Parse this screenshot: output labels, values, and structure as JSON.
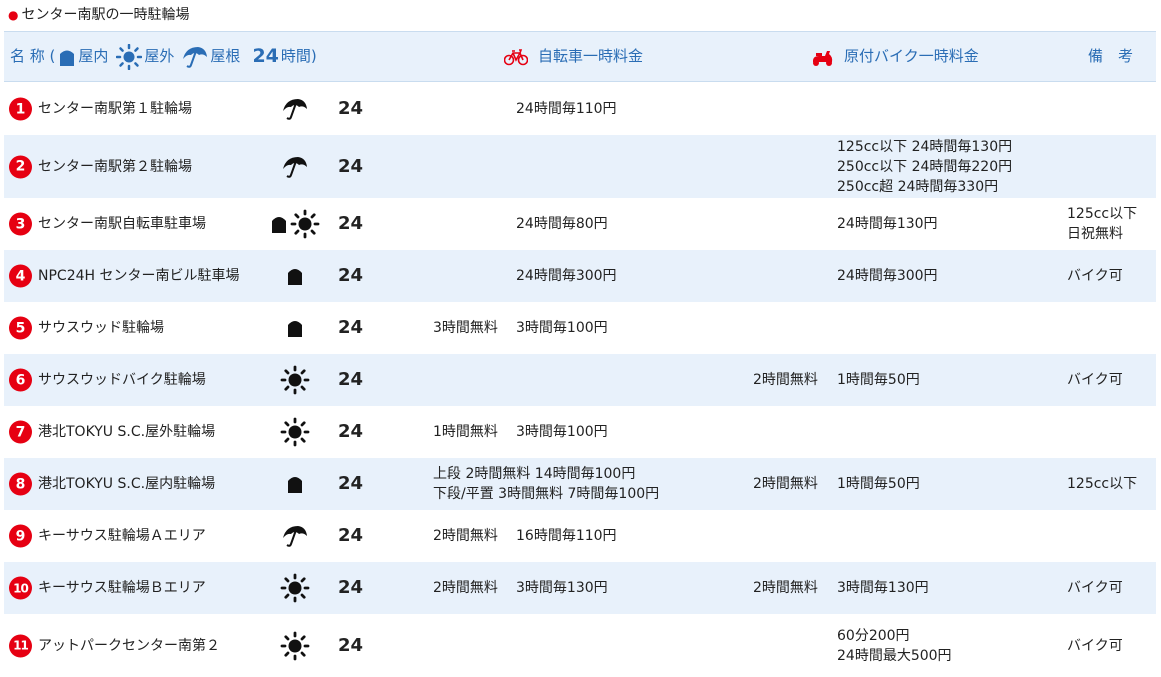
{
  "title": "センター南駅の一時駐輪場",
  "header": {
    "name_label": "名 称 (",
    "legend_indoor": "屋内",
    "legend_outdoor": "屋外",
    "legend_roof": "屋根",
    "legend_24": "24",
    "legend_24_suffix": "時間)",
    "bicycle_fee": "自転車一時料金",
    "moped_fee": "原付バイク一時料金",
    "notes": "備　考"
  },
  "colors": {
    "accent_red": "#e60012",
    "header_blue": "#2a6db5",
    "row_alt": "#e8f1fb"
  },
  "rows": [
    {
      "num": "1",
      "name": "センター南駅第１駐輪場",
      "icons": [
        "umbrella-icon"
      ],
      "hours": "24",
      "bike_free": "",
      "bike_fee": "24時間毎110円",
      "moto_free": "",
      "moto_lines": [],
      "note_lines": []
    },
    {
      "num": "2",
      "name": "センター南駅第２駐輪場",
      "icons": [
        "umbrella-icon"
      ],
      "hours": "24",
      "bike_free": "",
      "bike_fee": "",
      "moto_free": "",
      "moto_lines": [
        "125cc以下 24時間毎130円",
        "250cc以下 24時間毎220円",
        "250cc超 24時間毎330円"
      ],
      "note_lines": []
    },
    {
      "num": "3",
      "name": "センター南駅自転車駐車場",
      "icons": [
        "building-icon",
        "sun-icon"
      ],
      "hours": "24",
      "bike_free": "",
      "bike_fee": "24時間毎80円",
      "moto_free": "",
      "moto_lines": [
        "24時間毎130円"
      ],
      "note_lines": [
        "125cc以下",
        "日祝無料"
      ]
    },
    {
      "num": "4",
      "name": "NPC24H センター南ビル駐車場",
      "icons": [
        "building-icon"
      ],
      "hours": "24",
      "bike_free": "",
      "bike_fee": "24時間毎300円",
      "moto_free": "",
      "moto_lines": [
        "24時間毎300円"
      ],
      "note_lines": [
        "バイク可"
      ]
    },
    {
      "num": "5",
      "name": "サウスウッド駐輪場",
      "icons": [
        "building-icon"
      ],
      "hours": "24",
      "bike_free": "3時間無料",
      "bike_fee": "3時間毎100円",
      "moto_free": "",
      "moto_lines": [],
      "note_lines": []
    },
    {
      "num": "6",
      "name": "サウスウッドバイク駐輪場",
      "icons": [
        "sun-icon"
      ],
      "hours": "24",
      "bike_free": "",
      "bike_fee": "",
      "moto_free": "2時間無料",
      "moto_lines": [
        "1時間毎50円"
      ],
      "note_lines": [
        "バイク可"
      ]
    },
    {
      "num": "7",
      "name": "港北TOKYU S.C.屋外駐輪場",
      "icons": [
        "sun-icon"
      ],
      "hours": "24",
      "bike_free": "1時間無料",
      "bike_fee": "3時間毎100円",
      "moto_free": "",
      "moto_lines": [],
      "note_lines": []
    },
    {
      "num": "8",
      "name": "港北TOKYU S.C.屋内駐輪場",
      "icons": [
        "building-icon"
      ],
      "hours": "24",
      "bike_lines": [
        "上段 2時間無料 14時間毎100円",
        "下段/平置 3時間無料 7時間毎100円"
      ],
      "moto_free": "2時間無料",
      "moto_lines": [
        "1時間毎50円"
      ],
      "note_lines": [
        "125cc以下"
      ]
    },
    {
      "num": "9",
      "name": "キーサウス駐輪場Ａエリア",
      "icons": [
        "umbrella-icon"
      ],
      "hours": "24",
      "bike_free": "2時間無料",
      "bike_fee": "16時間毎110円",
      "moto_free": "",
      "moto_lines": [],
      "note_lines": []
    },
    {
      "num": "10",
      "name": "キーサウス駐輪場Ｂエリア",
      "icons": [
        "sun-icon"
      ],
      "hours": "24",
      "bike_free": "2時間無料",
      "bike_fee": "3時間毎130円",
      "moto_free": "2時間無料",
      "moto_lines": [
        "3時間毎130円"
      ],
      "note_lines": [
        "バイク可"
      ]
    },
    {
      "num": "11",
      "name": "アットパークセンター南第２",
      "icons": [
        "sun-icon"
      ],
      "hours": "24",
      "bike_free": "",
      "bike_fee": "",
      "moto_free": "",
      "moto_lines": [
        "60分200円",
        "24時間最大500円"
      ],
      "note_lines": [
        "バイク可"
      ]
    }
  ]
}
